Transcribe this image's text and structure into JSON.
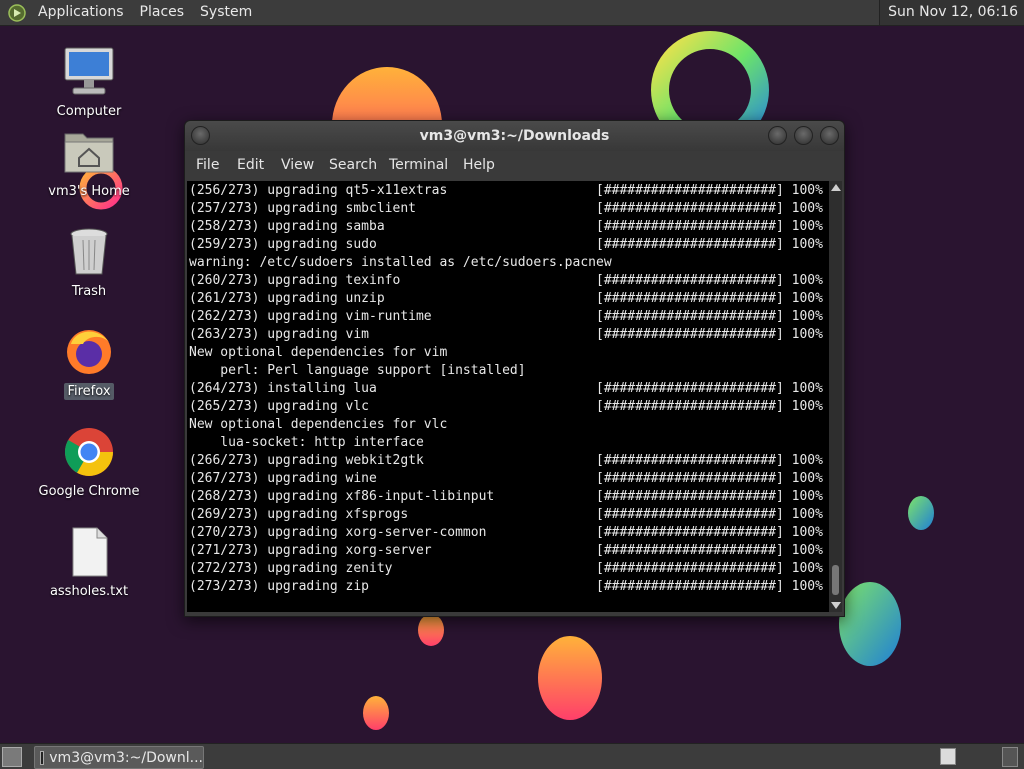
{
  "top_panel": {
    "menus": [
      "Applications",
      "Places",
      "System"
    ],
    "clock": "Sun Nov 12, 06:16"
  },
  "desktop_icons": {
    "computer": "Computer",
    "home": "vm3's Home",
    "trash": "Trash",
    "firefox": "Firefox",
    "chrome": "Google Chrome",
    "textfile": "assholes.txt"
  },
  "terminal": {
    "title": "vm3@vm3:~/Downloads",
    "menu": [
      "File",
      "Edit",
      "View",
      "Search",
      "Terminal",
      "Help"
    ],
    "lines": [
      "(256/273) upgrading qt5-x11extras                   [######################] 100%",
      "(257/273) upgrading smbclient                       [######################] 100%",
      "(258/273) upgrading samba                           [######################] 100%",
      "(259/273) upgrading sudo                            [######################] 100%",
      "warning: /etc/sudoers installed as /etc/sudoers.pacnew",
      "(260/273) upgrading texinfo                         [######################] 100%",
      "(261/273) upgrading unzip                           [######################] 100%",
      "(262/273) upgrading vim-runtime                     [######################] 100%",
      "(263/273) upgrading vim                             [######################] 100%",
      "New optional dependencies for vim",
      "    perl: Perl language support [installed]",
      "(264/273) installing lua                            [######################] 100%",
      "(265/273) upgrading vlc                             [######################] 100%",
      "New optional dependencies for vlc",
      "    lua-socket: http interface",
      "(266/273) upgrading webkit2gtk                      [######################] 100%",
      "(267/273) upgrading wine                            [######################] 100%",
      "(268/273) upgrading xf86-input-libinput             [######################] 100%",
      "(269/273) upgrading xfsprogs                        [######################] 100%",
      "(270/273) upgrading xorg-server-common              [######################] 100%",
      "(271/273) upgrading xorg-server                     [######################] 100%",
      "(272/273) upgrading zenity                          [######################] 100%",
      "(273/273) upgrading zip                             [######################] 100%"
    ]
  },
  "bottom_panel": {
    "task_label": "vm3@vm3:~/Downl..."
  }
}
